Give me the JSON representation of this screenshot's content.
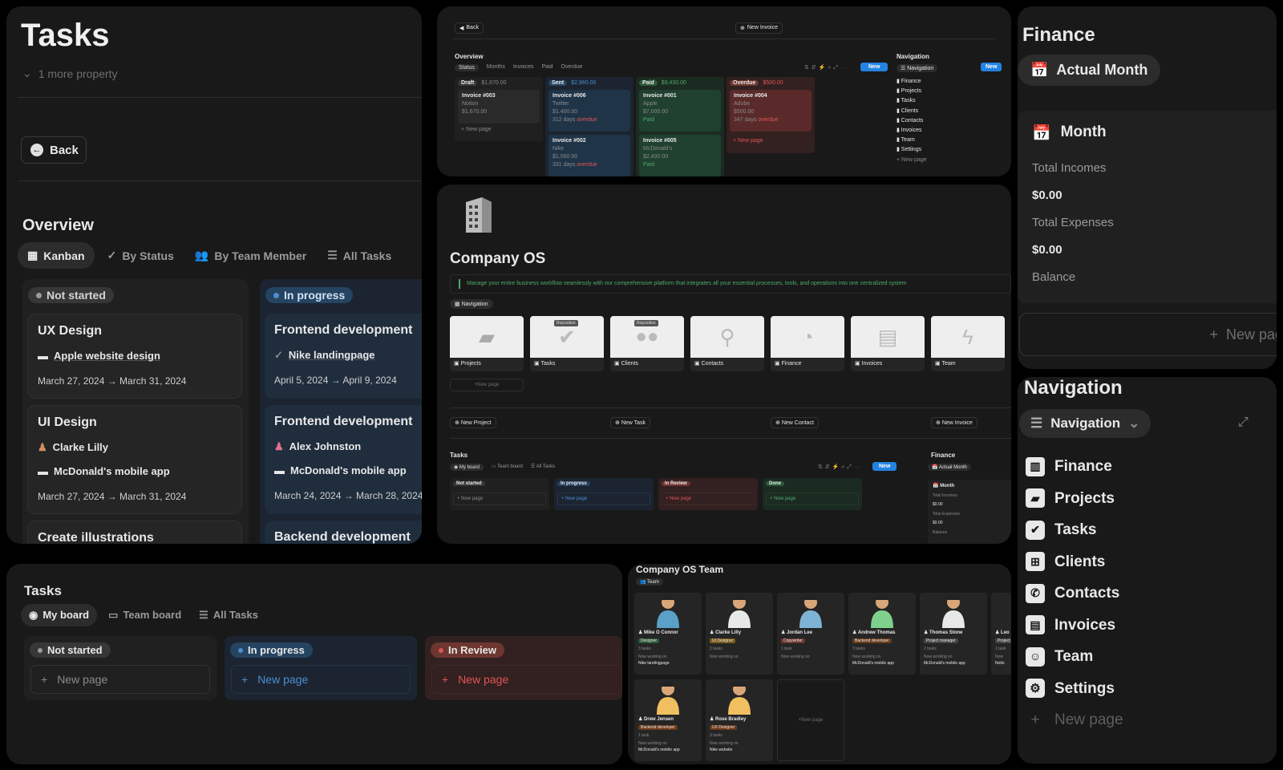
{
  "p1": {
    "title": "Tasks",
    "more_property": "1 more property",
    "back": "Back",
    "overview": "Overview",
    "tabs": [
      {
        "label": "Kanban",
        "icon": "table-icon"
      },
      {
        "label": "By Status",
        "icon": "check-circle-icon"
      },
      {
        "label": "By Team Member",
        "icon": "people-icon"
      },
      {
        "label": "All Tasks",
        "icon": "list-icon"
      }
    ],
    "col1": {
      "status": "Not started",
      "cards": [
        {
          "title": "UX Design",
          "project": "Apple website design",
          "dates": "March 27, 2024 → March 31, 2024"
        },
        {
          "title": "UI Design",
          "person": "Clarke Lilly",
          "project": "McDonald's mobile app",
          "dates": "March 27, 2024 → March 31, 2024"
        },
        {
          "title": "Create illustrations"
        }
      ]
    },
    "col2": {
      "status": "In progress",
      "cards": [
        {
          "title": "Frontend development",
          "project": "Nike landingpage",
          "dates": "April 5, 2024 → April 9, 2024"
        },
        {
          "title": "Frontend development",
          "person": "Alex Johnston",
          "project": "McDonald's mobile app",
          "dates": "March 24, 2024 → March 28, 2024"
        },
        {
          "title": "Backend development"
        }
      ]
    }
  },
  "p2": {
    "back": "Back",
    "new_invoice": "New Invoice",
    "overview": "Overview",
    "tabs": [
      "Status",
      "Months",
      "Invoices",
      "Paid",
      "Overdue"
    ],
    "new": "New",
    "cols": [
      {
        "label": "Draft",
        "total": "$1,670.00",
        "cards": [
          {
            "title": "Invoice #003",
            "client": "Notion",
            "amount": "$1,670.00"
          }
        ]
      },
      {
        "label": "Sent",
        "total": "$2,960.00",
        "cards": [
          {
            "title": "Invoice #006",
            "client": "Twitter",
            "amount": "$1,400.00",
            "note": "312 days",
            "overdue": "overdue"
          },
          {
            "title": "Invoice #002",
            "client": "Nike",
            "amount": "$1,560.00",
            "note": "331 days",
            "overdue": "overdue"
          }
        ]
      },
      {
        "label": "Paid",
        "total": "$9,430.00",
        "cards": [
          {
            "title": "Invoice #001",
            "client": "Apple",
            "amount": "$7,000.00",
            "paid": "Paid"
          },
          {
            "title": "Invoice #005",
            "client": "McDonald's",
            "amount": "$2,430.00",
            "paid": "Paid"
          }
        ]
      },
      {
        "label": "Overdue",
        "total": "$500.00",
        "cards": [
          {
            "title": "Invoice #004",
            "client": "Adobe",
            "amount": "$500.00",
            "note": "347 days",
            "overdue": "overdue"
          }
        ]
      }
    ],
    "new_page": "New page",
    "nav_title": "Navigation",
    "nav_tab": "Navigation",
    "nav_items": [
      "Finance",
      "Projects",
      "Tasks",
      "Clients",
      "Contacts",
      "Invoices",
      "Team",
      "Settings"
    ]
  },
  "p3": {
    "title": "Finance",
    "tab": "Actual Month",
    "month": "Month",
    "incomes_label": "Total Incomes",
    "incomes": "$0.00",
    "expenses_label": "Total Expenses",
    "expenses": "$0.00",
    "balance_label": "Balance",
    "new_page": "New pag"
  },
  "p4": {
    "title": "Company OS",
    "desc": "Manage your entire business workflow seamlessly with our comprehensive platform that integrates all your essential processes, tools, and operations into one centralized system",
    "nav_tab": "Navigation",
    "reposition": "Reposition",
    "gallery": [
      "Projects",
      "Tasks",
      "Clients",
      "Contacts",
      "Finance",
      "Invoices",
      "Team"
    ],
    "new_page": "New page",
    "buttons": [
      "New Project",
      "New Task",
      "New Contact",
      "New Invoice"
    ],
    "tasks_title": "Tasks",
    "tasks_tabs": [
      "My board",
      "Team board",
      "All Tasks"
    ],
    "new": "New",
    "statuses": [
      "Not started",
      "In progress",
      "In Review",
      "Done"
    ],
    "finance_title": "Finance",
    "finance_tab": "Actual Month",
    "month": "Month",
    "total_incomes": "Total Incomes",
    "v1": "$0.00",
    "total_expenses": "Total Expenses",
    "v2": "$0.00",
    "balance": "Balance"
  },
  "p5": {
    "title": "Navigation",
    "tab": "Navigation",
    "items": [
      {
        "label": "Finance",
        "icon": "chart-icon"
      },
      {
        "label": "Projects",
        "icon": "folder-icon"
      },
      {
        "label": "Tasks",
        "icon": "check-icon"
      },
      {
        "label": "Clients",
        "icon": "briefcase-icon"
      },
      {
        "label": "Contacts",
        "icon": "phone-icon"
      },
      {
        "label": "Invoices",
        "icon": "document-icon"
      },
      {
        "label": "Team",
        "icon": "user-circle-icon"
      },
      {
        "label": "Settings",
        "icon": "gear-icon"
      }
    ],
    "new_page": "New page"
  },
  "p6": {
    "title": "Tasks",
    "tabs": [
      "My board",
      "Team board",
      "All Tasks"
    ],
    "statuses": [
      "Not started",
      "In progress",
      "In Review"
    ],
    "new_page": "New page"
  },
  "p7": {
    "title": "Company OS Team",
    "tab": "Team",
    "members": [
      {
        "name": "Mike O Connor",
        "role": "Designer",
        "tasks": "3 tasks",
        "working": "Now working on",
        "project": "Nike landingpage"
      },
      {
        "name": "Clarke Lilly",
        "role": "UI Designer",
        "tasks": "3 tasks",
        "working": "Now working on",
        "project": ""
      },
      {
        "name": "Jordan Lee",
        "role": "Copywriter",
        "tasks": "1 task",
        "working": "Now working on",
        "project": ""
      },
      {
        "name": "Andrew Thomas",
        "role": "Backend developer",
        "tasks": "3 tasks",
        "working": "Now working on",
        "project": "McDonald's mobile app"
      },
      {
        "name": "Thomas Stone",
        "role": "Project manager",
        "tasks": "2 tasks",
        "working": "Now working on",
        "project": "McDonald's mobile app"
      },
      {
        "name": "Leo",
        "role": "Project",
        "tasks": "1 task",
        "working": "Now",
        "project": "Notio"
      },
      {
        "name": "Drew Jensen",
        "role": "Backend developer",
        "tasks": "1 task",
        "working": "Now working on",
        "project": "McDonald's mobile app"
      },
      {
        "name": "Rose Bradley",
        "role": "UX Designer",
        "tasks": "3 tasks",
        "working": "Now working on",
        "project": "Nike website"
      }
    ],
    "new_page": "New page"
  }
}
